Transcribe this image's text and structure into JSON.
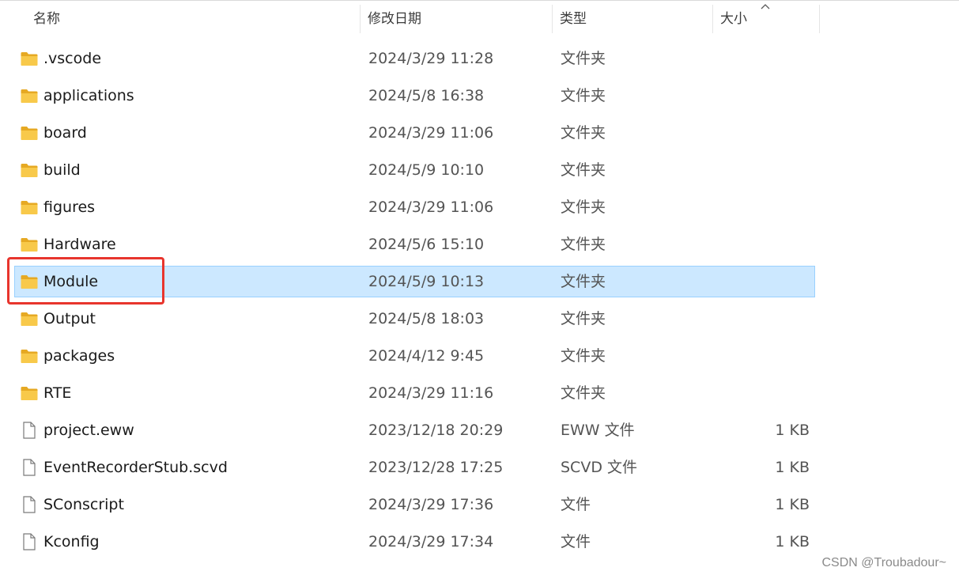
{
  "header": {
    "name_label": "名称",
    "date_label": "修改日期",
    "type_label": "类型",
    "size_label": "大小"
  },
  "rows": [
    {
      "name": ".vscode",
      "date": "2024/3/29 11:28",
      "type": "文件夹",
      "size": "",
      "icon": "folder-icon"
    },
    {
      "name": "applications",
      "date": "2024/5/8 16:38",
      "type": "文件夹",
      "size": "",
      "icon": "folder-icon"
    },
    {
      "name": "board",
      "date": "2024/3/29 11:06",
      "type": "文件夹",
      "size": "",
      "icon": "folder-icon"
    },
    {
      "name": "build",
      "date": "2024/5/9 10:10",
      "type": "文件夹",
      "size": "",
      "icon": "folder-icon"
    },
    {
      "name": "figures",
      "date": "2024/3/29 11:06",
      "type": "文件夹",
      "size": "",
      "icon": "folder-icon"
    },
    {
      "name": "Hardware",
      "date": "2024/5/6 15:10",
      "type": "文件夹",
      "size": "",
      "icon": "folder-icon"
    },
    {
      "name": "Module",
      "date": "2024/5/9 10:13",
      "type": "文件夹",
      "size": "",
      "icon": "folder-icon",
      "selected": true
    },
    {
      "name": "Output",
      "date": "2024/5/8 18:03",
      "type": "文件夹",
      "size": "",
      "icon": "folder-icon"
    },
    {
      "name": "packages",
      "date": "2024/4/12 9:45",
      "type": "文件夹",
      "size": "",
      "icon": "folder-icon"
    },
    {
      "name": "RTE",
      "date": "2024/3/29 11:16",
      "type": "文件夹",
      "size": "",
      "icon": "folder-icon"
    },
    {
      "name": "project.eww",
      "date": "2023/12/18 20:29",
      "type": "EWW 文件",
      "size": "1 KB",
      "icon": "file-icon"
    },
    {
      "name": "EventRecorderStub.scvd",
      "date": "2023/12/28 17:25",
      "type": "SCVD 文件",
      "size": "1 KB",
      "icon": "file-icon"
    },
    {
      "name": "SConscript",
      "date": "2024/3/29 17:36",
      "type": "文件",
      "size": "1 KB",
      "icon": "file-icon"
    },
    {
      "name": "Kconfig",
      "date": "2024/3/29 17:34",
      "type": "文件",
      "size": "1 KB",
      "icon": "file-icon"
    }
  ],
  "watermark": "CSDN @Troubadour~",
  "colors": {
    "selection_bg": "#cce8ff",
    "selection_border": "#99d1ff",
    "annotation_red": "#e8352d",
    "folder_yellow": "#f8c94a"
  }
}
